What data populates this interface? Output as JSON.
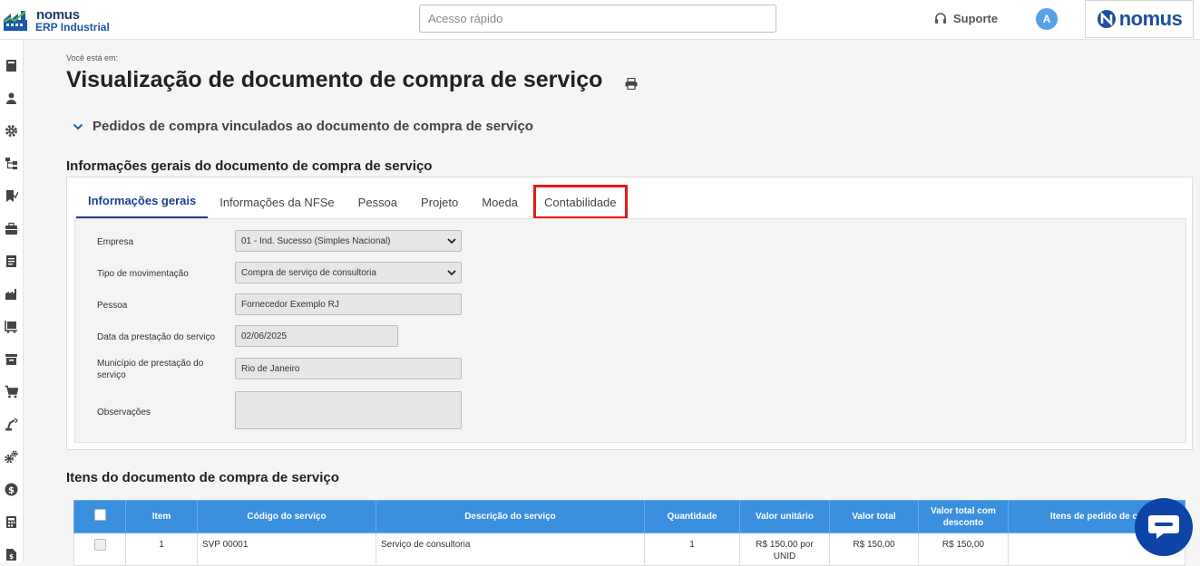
{
  "header": {
    "logo_line1": "nomus",
    "logo_line2": "ERP Industrial",
    "search_placeholder": "Acesso rápido",
    "support_label": "Suporte",
    "avatar_initial": "A",
    "brand_text": "nomus"
  },
  "sidebar": {
    "icons": [
      "book-icon",
      "user-icon",
      "gear-icon",
      "hierarchy-icon",
      "bookmark-icon",
      "briefcase-icon",
      "document-icon",
      "factory-icon",
      "pallet-icon",
      "archive-icon",
      "cart-icon",
      "robot-arm-icon",
      "gears-icon",
      "dollar-icon",
      "calculator-icon",
      "file-dollar-icon"
    ]
  },
  "breadcrumb": "Você está em:",
  "page_title": "Visualização de documento de compra de serviço",
  "accordion_label": "Pedidos de compra vinculados ao documento de compra de serviço",
  "general_section_title": "Informações gerais do documento de compra de serviço",
  "tabs": [
    {
      "label": "Informações gerais",
      "active": true
    },
    {
      "label": "Informações da NFSe",
      "active": false
    },
    {
      "label": "Pessoa",
      "active": false
    },
    {
      "label": "Projeto",
      "active": false
    },
    {
      "label": "Moeda",
      "active": false
    },
    {
      "label": "Contabilidade",
      "active": false,
      "highlighted": true
    }
  ],
  "form": {
    "empresa_label": "Empresa",
    "empresa_value": "01 - Ind. Sucesso (Simples Nacional)",
    "tipo_label": "Tipo de movimentação",
    "tipo_value": "Compra de serviço de consultoria",
    "pessoa_label": "Pessoa",
    "pessoa_value": "Fornecedor Exemplo RJ",
    "data_label": "Data da prestação do serviço",
    "data_value": "02/06/2025",
    "municipio_label_1": "Município de prestação do",
    "municipio_label_2": "serviço",
    "municipio_value": "Rio de Janeiro",
    "obs_label": "Observações",
    "obs_value": ""
  },
  "items_section_title": "Itens do documento de compra de serviço",
  "items_table": {
    "headers": [
      "Item",
      "Código do serviço",
      "Descrição do serviço",
      "Quantidade",
      "Valor unitário",
      "Valor total",
      "Valor total com desconto",
      "Itens de pedido de co"
    ],
    "rows": [
      {
        "item": "1",
        "codigo": "SVP 00001",
        "descricao": "Serviço de consultoria",
        "quantidade": "1",
        "valor_unitario": "R$ 150,00 por UNID",
        "valor_total": "R$ 150,00",
        "valor_desconto": "R$ 150,00",
        "itens_pedido": ""
      }
    ]
  },
  "colors": {
    "accent": "#1a3f8f",
    "table_header": "#3b8fdf",
    "highlight_border": "#e01b1b",
    "chat_button": "#0c45a7"
  }
}
